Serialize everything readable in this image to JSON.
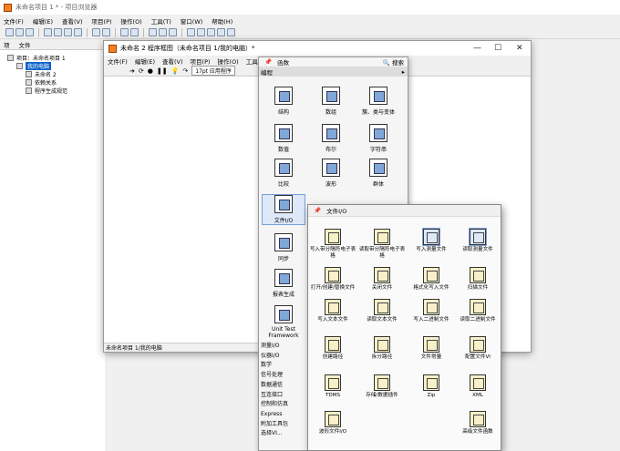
{
  "main_window": {
    "title": "未命名项目 1 * - 项目浏览器"
  },
  "main_menu": [
    "文件(F)",
    "编辑(E)",
    "查看(V)",
    "项目(P)",
    "操作(O)",
    "工具(T)",
    "窗口(W)",
    "帮助(H)"
  ],
  "project_tabs": [
    "项",
    "文件"
  ],
  "tree": {
    "root": "项目：未命名项目 1",
    "computer": "我的电脑",
    "vi": "未命名 2",
    "deps": "依赖关系",
    "build": "程序生成规范"
  },
  "diagram": {
    "title": "未命名 2 程序框图（未命名项目 1/我的电脑）*",
    "menu": [
      "文件(F)",
      "编辑(E)",
      "查看(V)",
      "项目(P)",
      "操作(O)",
      "工具(T)"
    ],
    "font_label": "17pt 应用程序",
    "status": "未命名项目 1/我的电脑"
  },
  "palette": {
    "title": "函数",
    "search": "搜索",
    "category": "编程",
    "items": [
      "结构",
      "数组",
      "簇、类与变体",
      "数值",
      "布尔",
      "字符串",
      "比较",
      "波形",
      "群体",
      "文件I/O",
      "同步",
      "报表生成",
      "Unit Test Framework"
    ],
    "categories": [
      "测量I/O",
      "仪器I/O",
      "数学",
      "信号处理",
      "数据通信",
      "互连接口",
      "控制和仿真",
      "Express",
      "附加工具包",
      "选择VI..."
    ]
  },
  "file_io": {
    "title": "文件I/O",
    "items": [
      "写入带分隔符电子表格",
      "读取带分隔符电子表格",
      "写入测量文件",
      "读取测量文件",
      "打开/创建/替换文件",
      "关闭文件",
      "格式化写入文件",
      "扫描文件",
      "写入文本文件",
      "读取文本文件",
      "写入二进制文件",
      "读取二进制文件",
      "创建路径",
      "拆分路径",
      "文件常量",
      "配置文件VI",
      "TDMS",
      "存储/数据插件",
      "Zip",
      "XML",
      "波形文件I/O",
      "高级文件函数"
    ]
  }
}
